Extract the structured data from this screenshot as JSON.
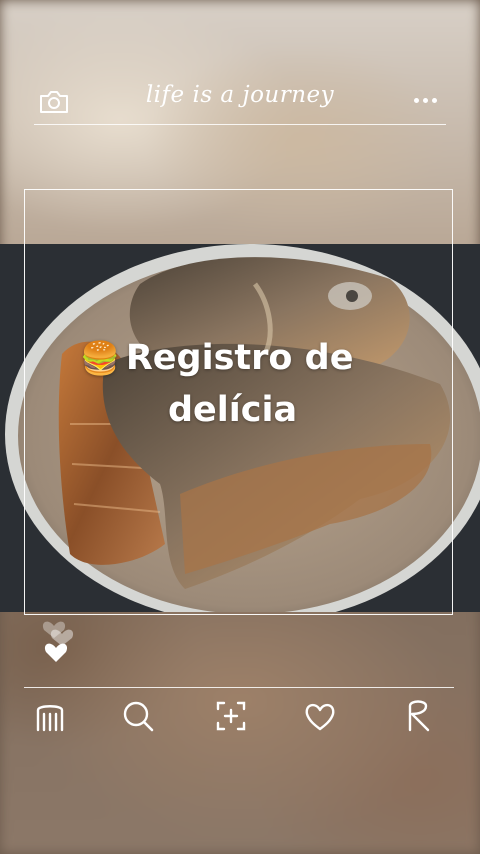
{
  "header": {
    "title": "life is a journey",
    "left_icon": "camera-icon",
    "right_icon": "more-dots-icon"
  },
  "post": {
    "caption_emoji": "🍔",
    "caption_line1": "Registro de",
    "caption_line2": "delícia"
  },
  "reactions": {
    "icon": "heart-icon"
  },
  "bottom_nav": {
    "items": [
      {
        "icon": "home-icon"
      },
      {
        "icon": "search-icon"
      },
      {
        "icon": "add-frame-icon"
      },
      {
        "icon": "heart-icon"
      },
      {
        "icon": "profile-icon"
      }
    ]
  },
  "colors": {
    "foreground": "#ffffff"
  }
}
